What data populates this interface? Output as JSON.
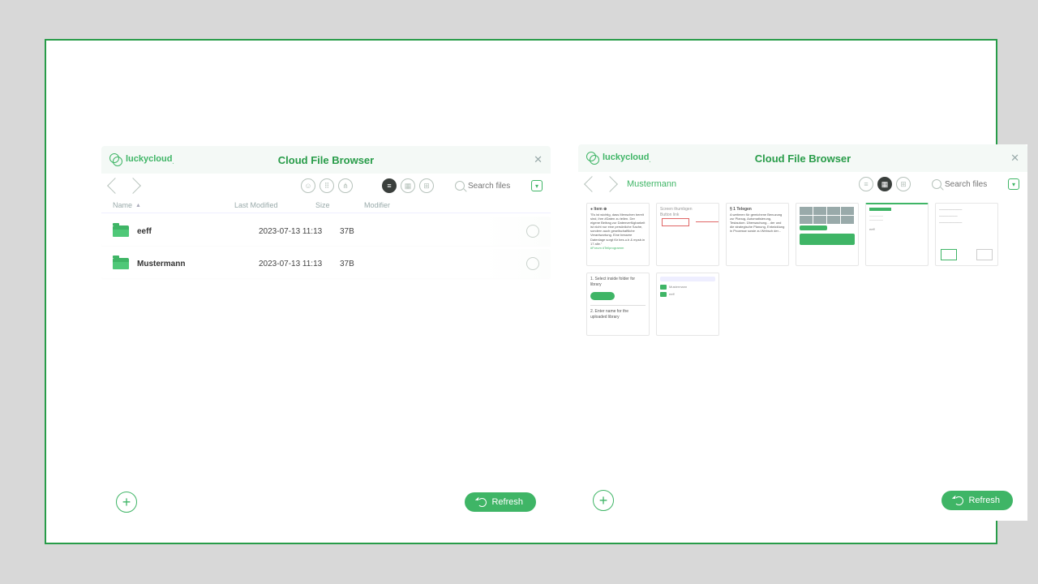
{
  "brand": {
    "name": "luckycloud",
    "suffix": "."
  },
  "title": "Cloud File Browser",
  "search_placeholder": "Search files",
  "columns": {
    "name": "Name",
    "modified": "Last Modified",
    "size": "Size",
    "modifier": "Modifier"
  },
  "left_view": {
    "rows": [
      {
        "name": "eeff",
        "modified": "2023-07-13 11:13",
        "size": "37B"
      },
      {
        "name": "Mustermann",
        "modified": "2023-07-13 11:13",
        "size": "37B"
      }
    ]
  },
  "right_view": {
    "breadcrumb": "Mustermann",
    "thumb_count": 8
  },
  "buttons": {
    "refresh": "Refresh"
  }
}
